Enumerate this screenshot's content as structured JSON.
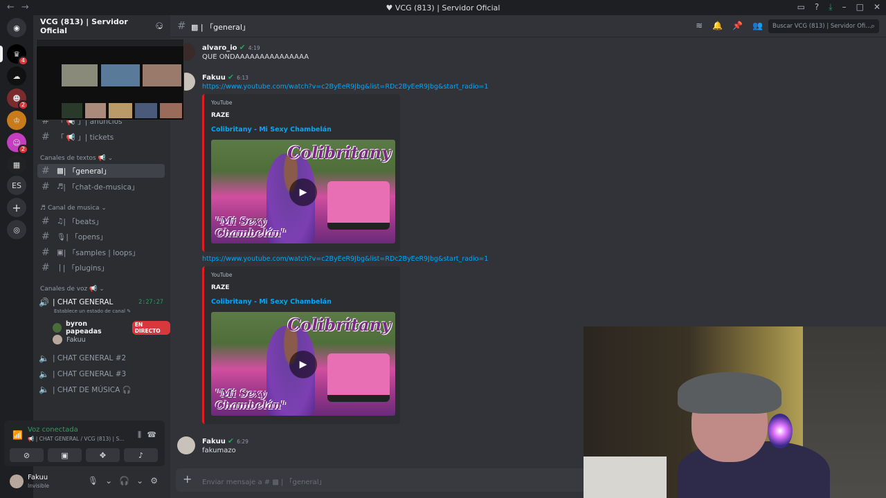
{
  "titlebar": {
    "title": "VCG (813) | Servidor Oficial"
  },
  "rail": {
    "badges": [
      "4",
      "2",
      "2"
    ],
    "lang": "ES"
  },
  "server": {
    "name": "VCG (813) | Servidor Oficial"
  },
  "channels": {
    "top": [
      "「 📢 」| anuncios",
      "「 📢 」| tickets"
    ],
    "cat_text": "Canales de textos 📢",
    "text": [
      "| 「general」",
      "| 「chat-de-musica」"
    ],
    "cat_music": "Canal de musica",
    "music": [
      "| 「beats」",
      "| 「opens」",
      "| 「samples | loops」",
      "| 「plugins」"
    ],
    "cat_voice": "Canales de voz 📢",
    "voice_active": "| CHAT GENERAL",
    "voice_timer": "2:27:27",
    "voice_status": "Establece un estado de canal",
    "voice_users": [
      "byron papeadas",
      "Fakuu"
    ],
    "live_label": "EN DIRECTO",
    "voice_other": [
      "| CHAT GENERAL #2",
      "| CHAT GENERAL #3",
      "| CHAT DE MÚSICA 🎧"
    ]
  },
  "voice_panel": {
    "status": "Voz conectada",
    "sub": "📢 | CHAT GENERAL / VCG (813) | S..."
  },
  "user_panel": {
    "name": "Fakuu",
    "state": "Invisible"
  },
  "chat": {
    "channel": "| 「general」",
    "search_placeholder": "Buscar VCG (813) | Servidor Ofi...",
    "messages": [
      {
        "author": "alvaro_io",
        "time": "4:19",
        "text": "QUE ONDAAAAAAAAAAAAAAA"
      },
      {
        "author": "Fakuu",
        "time": "6:13",
        "link": "https://www.youtube.com/watch?v=c2ByEeR9Jbg&list=RDc2ByEeR9Jbg&start_radio=1"
      },
      {
        "link": "https://www.youtube.com/watch?v=c2ByEeR9Jbg&list=RDc2ByEeR9Jbg&start_radio=1"
      },
      {
        "author": "Fakuu",
        "time": "6:29",
        "text": "fakumazo"
      }
    ],
    "embed": {
      "provider": "YouTube",
      "author": "RAZE",
      "title": "Colibritany - Mi Sexy Chambelán",
      "thumb_title": "Colibritany",
      "thumb_sub": "\"Mi Sexy Chambelán\""
    },
    "composer_placeholder": "Enviar mensaje a # ▩ | 「general」"
  },
  "colors": {
    "accent_green": "#23a55a",
    "link": "#00a8fc",
    "youtube_red": "#e21c24"
  }
}
